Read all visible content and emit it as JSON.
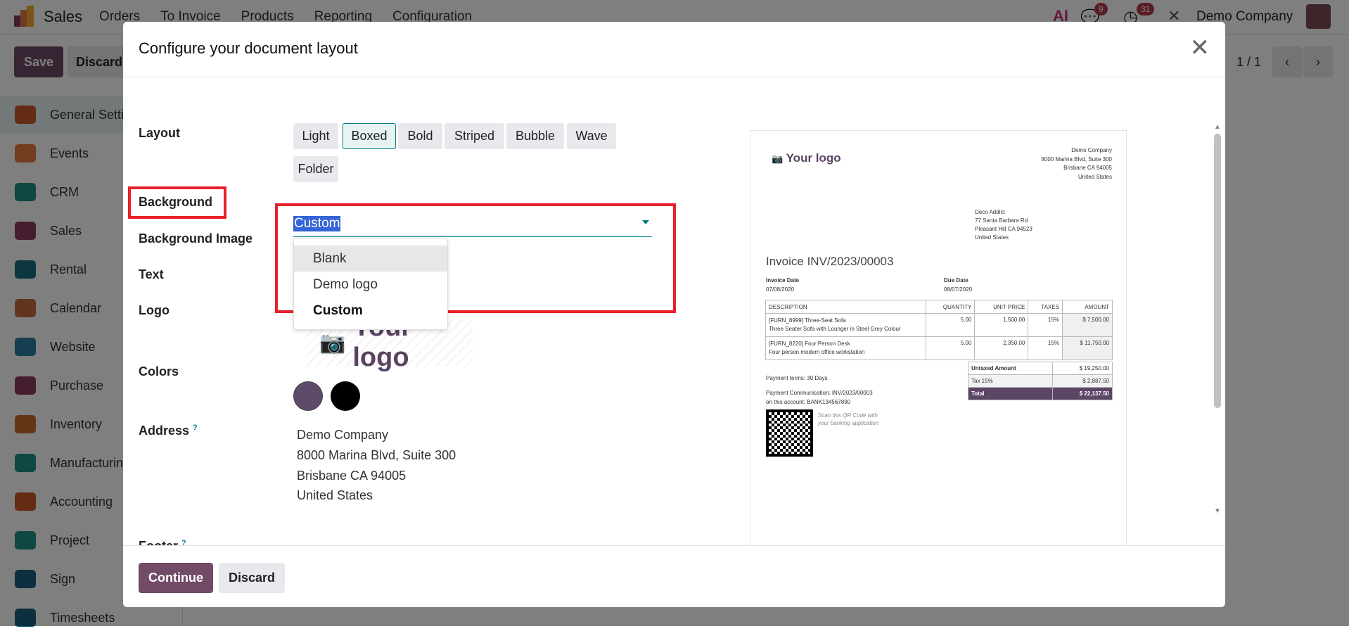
{
  "topnav": {
    "app": "Sales",
    "menus": [
      "Orders",
      "To Invoice",
      "Products",
      "Reporting",
      "Configuration"
    ],
    "messages_badge": "9",
    "activities_badge": "31",
    "company": "Demo Company",
    "ai_label": "AI"
  },
  "controlbar": {
    "save": "Save",
    "discard": "Discard",
    "pager": "1 / 1"
  },
  "sidebar": [
    "General Settings",
    "Events",
    "CRM",
    "Sales",
    "Rental",
    "Calendar",
    "Website",
    "Purchase",
    "Inventory",
    "Manufacturing",
    "Accounting",
    "Project",
    "Sign",
    "Timesheets"
  ],
  "modal": {
    "title": "Configure your document layout",
    "labels": {
      "layout": "Layout",
      "background": "Background",
      "background_image": "Background Image",
      "text": "Text",
      "logo": "Logo",
      "colors": "Colors",
      "address": "Address",
      "address_help": "?",
      "footer": "Footer",
      "footer_help": "?"
    },
    "layouts": [
      "Light",
      "Boxed",
      "Bold",
      "Striped",
      "Bubble",
      "Wave",
      "Folder"
    ],
    "selected_layout": "Boxed",
    "background": {
      "value": "Custom",
      "options": [
        "Blank",
        "Demo logo",
        "Custom"
      ]
    },
    "logo_text": "Your logo",
    "colors": [
      "#5f4a6b",
      "#000000"
    ],
    "address": [
      "Demo Company",
      "8000 Marina Blvd, Suite 300",
      "Brisbane CA 94005",
      "United States"
    ],
    "continue": "Continue",
    "discard": "Discard"
  },
  "preview": {
    "logo": "Your logo",
    "company": [
      "Demo Company",
      "8000 Marina Blvd, Suite 300",
      "Brisbane CA 94005",
      "United States"
    ],
    "customer": [
      "Deco Addict",
      "77 Santa Barbara Rd",
      "Pleasant Hill CA 94523",
      "United States"
    ],
    "title": "Invoice INV/2023/00003",
    "invoice_date_label": "Invoice Date",
    "invoice_date": "07/08/2020",
    "due_date_label": "Due Date",
    "due_date": "08/07/2020",
    "columns": [
      "DESCRIPTION",
      "QUANTITY",
      "UNIT PRICE",
      "TAXES",
      "AMOUNT"
    ],
    "rows": [
      {
        "name": "[FURN_8999] Three-Seat Sofa",
        "desc": "Three Seater Sofa with Lounger in Steel Grey Colour",
        "qty": "5.00",
        "price": "1,500.00",
        "tax": "15%",
        "amount": "$ 7,500.00"
      },
      {
        "name": "[FURN_8220] Four Person Desk",
        "desc": "Four person modern office workstation",
        "qty": "5.00",
        "price": "2,350.00",
        "tax": "15%",
        "amount": "$ 11,750.00"
      }
    ],
    "untaxed_label": "Untaxed Amount",
    "untaxed": "$ 19,250.00",
    "tax_label": "Tax 15%",
    "tax": "$ 2,887.50",
    "total_label": "Total",
    "total": "$ 22,137.50",
    "payment_terms": "Payment terms: 30 Days",
    "payment_comm": "Payment Communication: INV/2023/00003",
    "account": "on this account: BANK134567890",
    "qr_note_1": "Scan this QR Code with",
    "qr_note_2": "your banking application"
  }
}
